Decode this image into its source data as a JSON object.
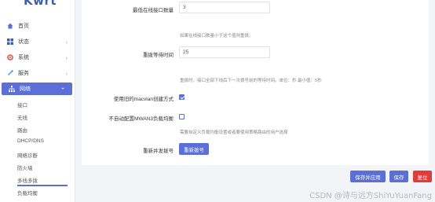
{
  "brand": {
    "logo_text": "Kwrt"
  },
  "sidebar": {
    "items": [
      {
        "label": "首页",
        "icon": "home-icon"
      },
      {
        "label": "状态",
        "icon": "status-icon"
      },
      {
        "label": "系统",
        "icon": "system-icon"
      },
      {
        "label": "服务",
        "icon": "service-icon"
      },
      {
        "label": "网络",
        "icon": "network-icon"
      }
    ],
    "sub_items": [
      "接口",
      "无线",
      "路由",
      "DHCP/DNS",
      "网络诊断",
      "防火墙",
      "多线多拨",
      "负载均衡"
    ],
    "accent": "#5b6fd6"
  },
  "form": {
    "min_iface": {
      "label": "最低在线接口数量",
      "value": "3",
      "hint": "如果在线接口数量小于这个值则重拨。"
    },
    "redial_wait": {
      "label": "重拨等待时间",
      "value": "25",
      "hint": "重拨时，接口全部下线后下一次拨号前的等待时间。单位：秒 最小值：5秒"
    },
    "use_old_macvlan": {
      "label": "使用旧的macvlan创建方式",
      "checked": true
    },
    "no_auto_mwan3": {
      "label": "不自动配置MWAN3负载均衡",
      "checked": false,
      "hint": "需要自定义负载均衡设置或者要使用策略路由的用户选择"
    },
    "redial": {
      "label": "重新并发拨号",
      "button": "重新拨号"
    }
  },
  "footer": {
    "save_apply": "保存并应用",
    "save": "保存",
    "reset": "复位"
  },
  "watermark": "CSDN @诗与远方ShiYuYuanFang"
}
